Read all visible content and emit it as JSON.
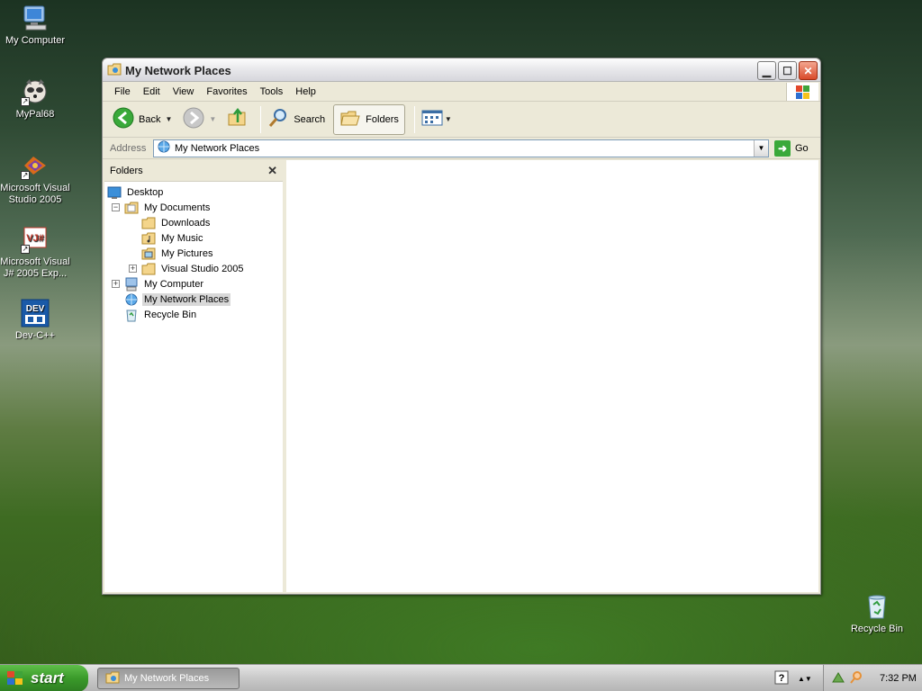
{
  "desktop": {
    "icons": [
      {
        "label": "My Computer"
      },
      {
        "label": "MyPal68"
      },
      {
        "label": "Microsoft Visual Studio 2005"
      },
      {
        "label": "Microsoft Visual J# 2005 Exp..."
      },
      {
        "label": "Dev-C++"
      },
      {
        "label": "Recycle Bin"
      }
    ],
    "devcpp_text": "DEV",
    "vj_text": "VJ#"
  },
  "window": {
    "title": "My Network Places",
    "menu": [
      "File",
      "Edit",
      "View",
      "Favorites",
      "Tools",
      "Help"
    ],
    "toolbar": {
      "back_label": "Back",
      "search_label": "Search",
      "folders_label": "Folders"
    },
    "address": {
      "label": "Address",
      "value": "My Network Places",
      "go_label": "Go"
    },
    "folders_pane": {
      "title": "Folders",
      "tree": [
        {
          "label": "Desktop"
        },
        {
          "label": "My Documents"
        },
        {
          "label": "Downloads"
        },
        {
          "label": "My Music"
        },
        {
          "label": "My Pictures"
        },
        {
          "label": "Visual Studio 2005"
        },
        {
          "label": "My Computer"
        },
        {
          "label": "My Network Places"
        },
        {
          "label": "Recycle Bin"
        }
      ]
    }
  },
  "taskbar": {
    "start_label": "start",
    "task_label": "My Network Places",
    "time": "7:32 PM"
  }
}
